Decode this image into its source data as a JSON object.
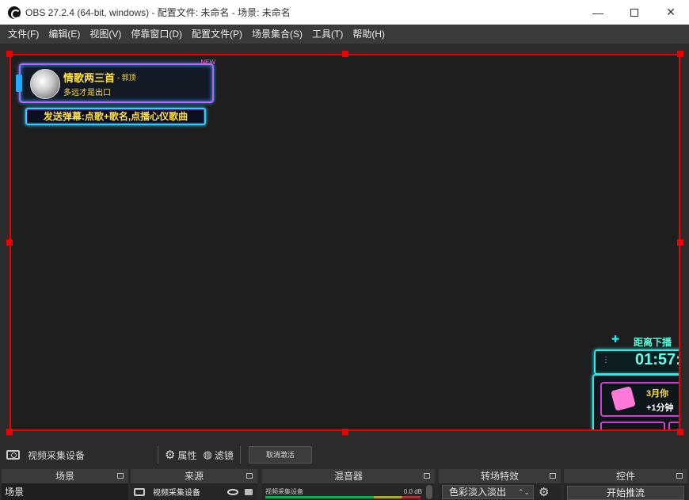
{
  "window": {
    "title": "OBS 27.2.4 (64-bit, windows) - 配置文件: 未命名 - 场景: 未命名",
    "minimize_glyph": "—",
    "close_glyph": "✕"
  },
  "menu": [
    "文件(F)",
    "编辑(E)",
    "视图(V)",
    "停靠窗口(D)",
    "配置文件(P)",
    "场景集合(S)",
    "工具(T)",
    "帮助(H)"
  ],
  "overlay": {
    "song_title": "情歌两三首",
    "song_artist": "- 郭顶",
    "song_line": "多远才是出口",
    "corner_badge": "NEW",
    "danmu_text": "发送弹幕:点歌+歌名,点播心仪歌曲",
    "countdown_label": "距离下播",
    "countdown_time": "01:57:",
    "promo_line1": "3月你",
    "promo_line2": "+1分钟"
  },
  "source_toolbar": {
    "source_name": "视频采集设备",
    "properties_label": "属性",
    "filters_label": "滤镜",
    "deactivate_label": "取消激活"
  },
  "docks": {
    "scenes": {
      "title": "场景",
      "items": [
        "场景"
      ]
    },
    "sources": {
      "title": "来源",
      "items": [
        "视频采集设备"
      ]
    },
    "mixer": {
      "title": "混音器",
      "channel": "视频采集设备",
      "db": "0.0 dB"
    },
    "transitions": {
      "title": "转场特效",
      "selected": "色彩淡入淡出"
    },
    "controls": {
      "title": "控件",
      "start_stream": "开始推流"
    }
  },
  "colors": {
    "selection": "#e00000",
    "accent_yellow": "#ffe14a",
    "accent_cyan": "#22eeee",
    "accent_pink": "#d23fd0"
  }
}
